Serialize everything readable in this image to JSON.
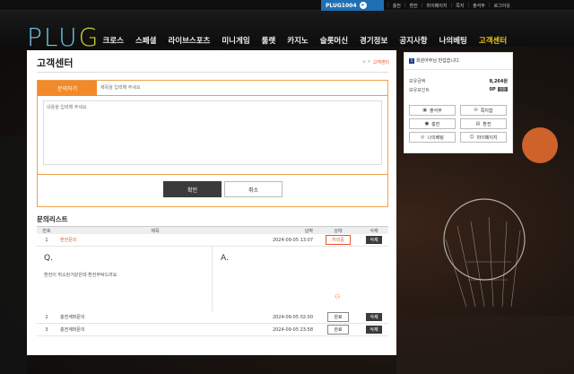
{
  "topbar": {
    "site_id": "PLUG1004",
    "links": [
      {
        "label": "충전",
        "count": ""
      },
      {
        "label": "환전",
        "count": ""
      },
      {
        "label": "마이페이지",
        "count": ""
      },
      {
        "label": "쪽지",
        "count": ""
      },
      {
        "label": "출석부",
        "count": ""
      },
      {
        "label": "로그아웃",
        "count": ""
      }
    ]
  },
  "logo": {
    "text_main": "PLU",
    "text_accent": "G"
  },
  "nav": {
    "items": [
      "크로스",
      "스페셜",
      "라이브스포츠",
      "미니게임",
      "룰렛",
      "카지노",
      "슬롯머신",
      "경기정보",
      "공지사항",
      "나의베팅",
      "고객센터"
    ],
    "active_index": 10
  },
  "panel": {
    "title": "고객센터",
    "breadcrumb": {
      "home_icon": "home-icon",
      "sep": ">",
      "current": "고객센터"
    }
  },
  "form": {
    "tab_label": "문의하기",
    "subject_placeholder": "제목을 입력해 주세요",
    "content_placeholder": "내용을 입력해 주세요",
    "confirm_label": "확인",
    "cancel_label": "취소"
  },
  "list": {
    "title": "문의리스트",
    "headers": {
      "no": "번호",
      "title": "제목",
      "date": "날짜",
      "status": "상태",
      "delete": "삭제"
    },
    "rows": [
      {
        "no": "1",
        "title": "환전문의",
        "date": "2024-09-05 13:07",
        "status": "처리중",
        "delete": "삭제"
      },
      {
        "no": "2",
        "title": "충전계좌문의",
        "date": "2024-09-05 02:00",
        "status": "완료",
        "delete": "삭제"
      },
      {
        "no": "3",
        "title": "충전계좌문의",
        "date": "2024-09-05 23:58",
        "status": "완료",
        "delete": "삭제"
      }
    ],
    "qa": {
      "q_letter": "Q.",
      "q_text": "환전이 취소된거같은데 환전부탁드려요",
      "a_letter": "A."
    }
  },
  "side": {
    "greeting": "회원아무님 반갑습니다.",
    "level_badge": "5",
    "balance_label": "보유금액",
    "balance_value": "8,264원",
    "points_label": "보유포인트",
    "points_value": "0P",
    "convert_label": "전환",
    "buttons": [
      {
        "label": "출석부",
        "icon": "calendar-icon"
      },
      {
        "label": "쪽지함",
        "icon": "mail-icon"
      },
      {
        "label": "충전",
        "icon": "deposit-icon"
      },
      {
        "label": "환전",
        "icon": "withdraw-icon"
      },
      {
        "label": "나의베팅",
        "icon": "betting-icon"
      },
      {
        "label": "마이페이지",
        "icon": "user-icon"
      }
    ]
  },
  "colors": {
    "accent": "#f28a2a",
    "active_nav": "#f0c419",
    "badge_blue": "#1f6fb3"
  }
}
